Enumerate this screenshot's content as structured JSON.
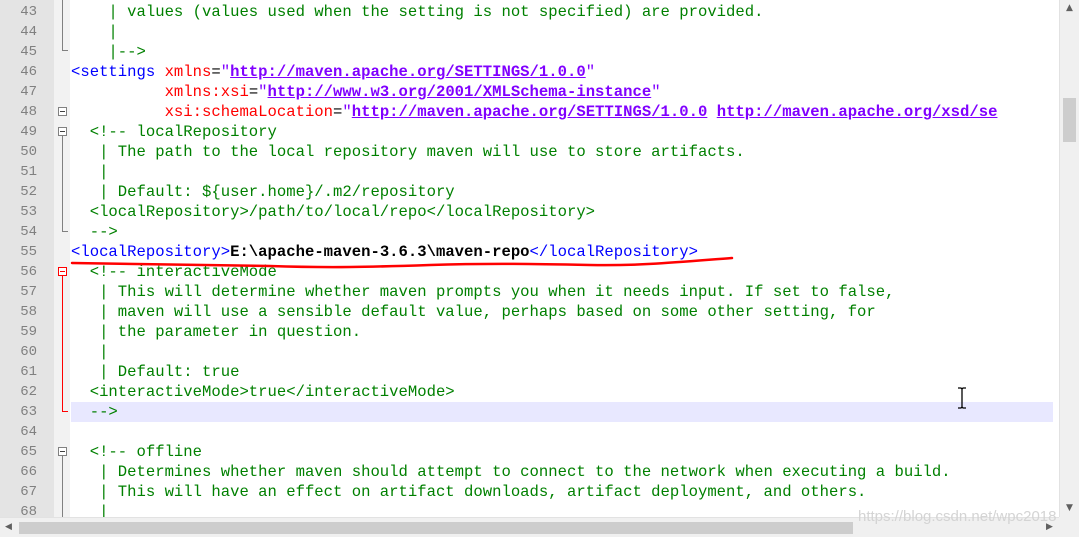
{
  "editor": {
    "lines": [
      {
        "num": "43",
        "segments": [
          {
            "t": "    | values (values used when the setting is not specified) are provided.",
            "c": "cm"
          }
        ]
      },
      {
        "num": "44",
        "segments": [
          {
            "t": "    |",
            "c": "cm"
          }
        ]
      },
      {
        "num": "45",
        "segments": [
          {
            "t": "    |-->",
            "c": "cm"
          }
        ]
      },
      {
        "num": "46",
        "segments": [
          {
            "t": "<settings ",
            "c": "tg"
          },
          {
            "t": "xmlns",
            "c": "at"
          },
          {
            "t": "=",
            "c": "plain"
          },
          {
            "t": "\"",
            "c": "vl"
          },
          {
            "t": "http://maven.apache.org/SETTINGS/1.0.0",
            "c": "lk"
          },
          {
            "t": "\"",
            "c": "vl"
          }
        ]
      },
      {
        "num": "47",
        "segments": [
          {
            "t": "          ",
            "c": "plain"
          },
          {
            "t": "xmlns:xsi",
            "c": "at"
          },
          {
            "t": "=",
            "c": "plain"
          },
          {
            "t": "\"",
            "c": "vl"
          },
          {
            "t": "http://www.w3.org/2001/XMLSchema-instance",
            "c": "lk"
          },
          {
            "t": "\"",
            "c": "vl"
          }
        ]
      },
      {
        "num": "48",
        "segments": [
          {
            "t": "          ",
            "c": "plain"
          },
          {
            "t": "xsi:schemaLocation",
            "c": "at"
          },
          {
            "t": "=",
            "c": "plain"
          },
          {
            "t": "\"",
            "c": "vl"
          },
          {
            "t": "http://maven.apache.org/SETTINGS/1.0.0",
            "c": "lk"
          },
          {
            "t": " ",
            "c": "vl"
          },
          {
            "t": "http://maven.apache.org/xsd/se",
            "c": "lk"
          }
        ]
      },
      {
        "num": "49",
        "segments": [
          {
            "t": "  <!-- localRepository",
            "c": "cm"
          }
        ]
      },
      {
        "num": "50",
        "segments": [
          {
            "t": "   | The path to the local repository maven will use to store artifacts.",
            "c": "cm"
          }
        ]
      },
      {
        "num": "51",
        "segments": [
          {
            "t": "   |",
            "c": "cm"
          }
        ]
      },
      {
        "num": "52",
        "segments": [
          {
            "t": "   | Default: ${user.home}/.m2/repository",
            "c": "cm"
          }
        ]
      },
      {
        "num": "53",
        "segments": [
          {
            "t": "  <localRepository>/path/to/local/repo</localRepository>",
            "c": "cm"
          }
        ]
      },
      {
        "num": "54",
        "segments": [
          {
            "t": "  -->",
            "c": "cm"
          }
        ]
      },
      {
        "num": "55",
        "segments": [
          {
            "t": "<localRepository>",
            "c": "tg"
          },
          {
            "t": "E:\\apache-maven-3.6.3\\maven-repo",
            "c": "bd"
          },
          {
            "t": "</localRepository>",
            "c": "tg"
          }
        ]
      },
      {
        "num": "56",
        "segments": [
          {
            "t": "  <!-- interactiveMode",
            "c": "cm"
          }
        ]
      },
      {
        "num": "57",
        "segments": [
          {
            "t": "   | This will determine whether maven prompts you when it needs input. If set to false,",
            "c": "cm"
          }
        ]
      },
      {
        "num": "58",
        "segments": [
          {
            "t": "   | maven will use a sensible default value, perhaps based on some other setting, for",
            "c": "cm"
          }
        ]
      },
      {
        "num": "59",
        "segments": [
          {
            "t": "   | the parameter in question.",
            "c": "cm"
          }
        ]
      },
      {
        "num": "60",
        "segments": [
          {
            "t": "   |",
            "c": "cm"
          }
        ]
      },
      {
        "num": "61",
        "segments": [
          {
            "t": "   | Default: true",
            "c": "cm"
          }
        ]
      },
      {
        "num": "62",
        "segments": [
          {
            "t": "  <interactiveMode>true</interactiveMode>",
            "c": "cm"
          }
        ]
      },
      {
        "num": "63",
        "segments": [
          {
            "t": "  -->",
            "c": "cm"
          }
        ]
      },
      {
        "num": "64",
        "segments": []
      },
      {
        "num": "65",
        "segments": [
          {
            "t": "  <!-- offline",
            "c": "cm"
          }
        ]
      },
      {
        "num": "66",
        "segments": [
          {
            "t": "   | Determines whether maven should attempt to connect to the network when executing a build.",
            "c": "cm"
          }
        ]
      },
      {
        "num": "67",
        "segments": [
          {
            "t": "   | This will have an effect on artifact downloads, artifact deployment, and others.",
            "c": "cm"
          }
        ]
      },
      {
        "num": "68",
        "segments": [
          {
            "t": "   |",
            "c": "cm"
          }
        ]
      }
    ],
    "highlighted_line": "63"
  },
  "watermark": "https://blog.csdn.net/wpc2018",
  "colors": {
    "comment": "#008000",
    "tag": "#0000ff",
    "attribute": "#ff0000",
    "value": "#8000ff",
    "annotation": "#ff0000",
    "current_line": "#e8e8ff"
  }
}
